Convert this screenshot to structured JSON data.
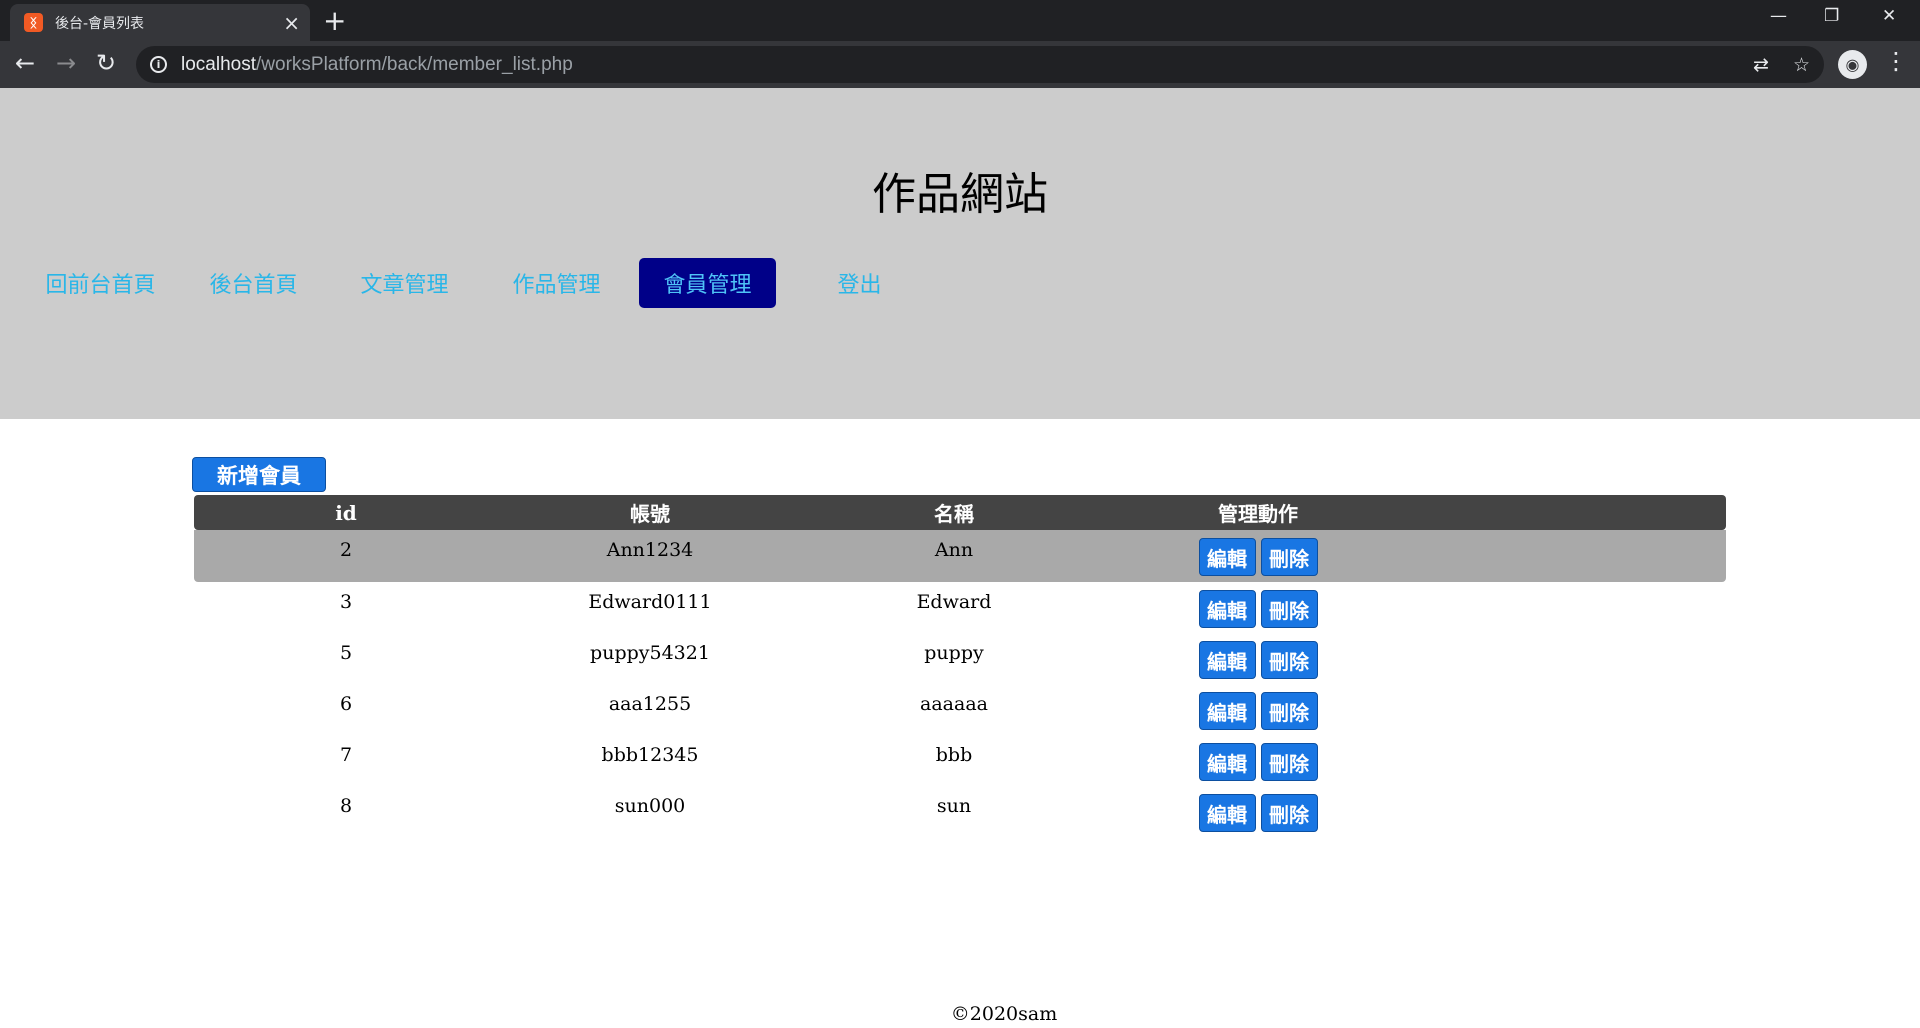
{
  "browser": {
    "tab_title": "後台-會員列表",
    "tab_favicon": "xampp-icon",
    "url_host": "localhost",
    "url_path": "/worksPlatform/back/member_list.php"
  },
  "site": {
    "title": "作品網站",
    "nav": [
      {
        "label": "回前台首頁"
      },
      {
        "label": "後台首頁"
      },
      {
        "label": "文章管理"
      },
      {
        "label": "作品管理"
      },
      {
        "label": "會員管理",
        "active": true
      },
      {
        "label": "登出"
      }
    ]
  },
  "members": {
    "add_label": "新增會員",
    "columns": [
      "id",
      "帳號",
      "名稱",
      "管理動作"
    ],
    "edit_label": "編輯",
    "delete_label": "刪除",
    "rows": [
      {
        "id": "2",
        "account": "Ann1234",
        "name": "Ann"
      },
      {
        "id": "3",
        "account": "Edward0111",
        "name": "Edward"
      },
      {
        "id": "5",
        "account": "puppy54321",
        "name": "puppy"
      },
      {
        "id": "6",
        "account": "aaa1255",
        "name": "aaaaaa"
      },
      {
        "id": "7",
        "account": "bbb12345",
        "name": "bbb"
      },
      {
        "id": "8",
        "account": "sun000",
        "name": "sun"
      }
    ]
  },
  "footer": "©2020sam",
  "colors": {
    "header_bg": "#cccccc",
    "nav_link": "#29b6e8",
    "nav_active_bg": "#000088",
    "button_blue": "#1976e3",
    "table_head_bg": "#444444",
    "row_highlight": "#a9a9a9"
  }
}
